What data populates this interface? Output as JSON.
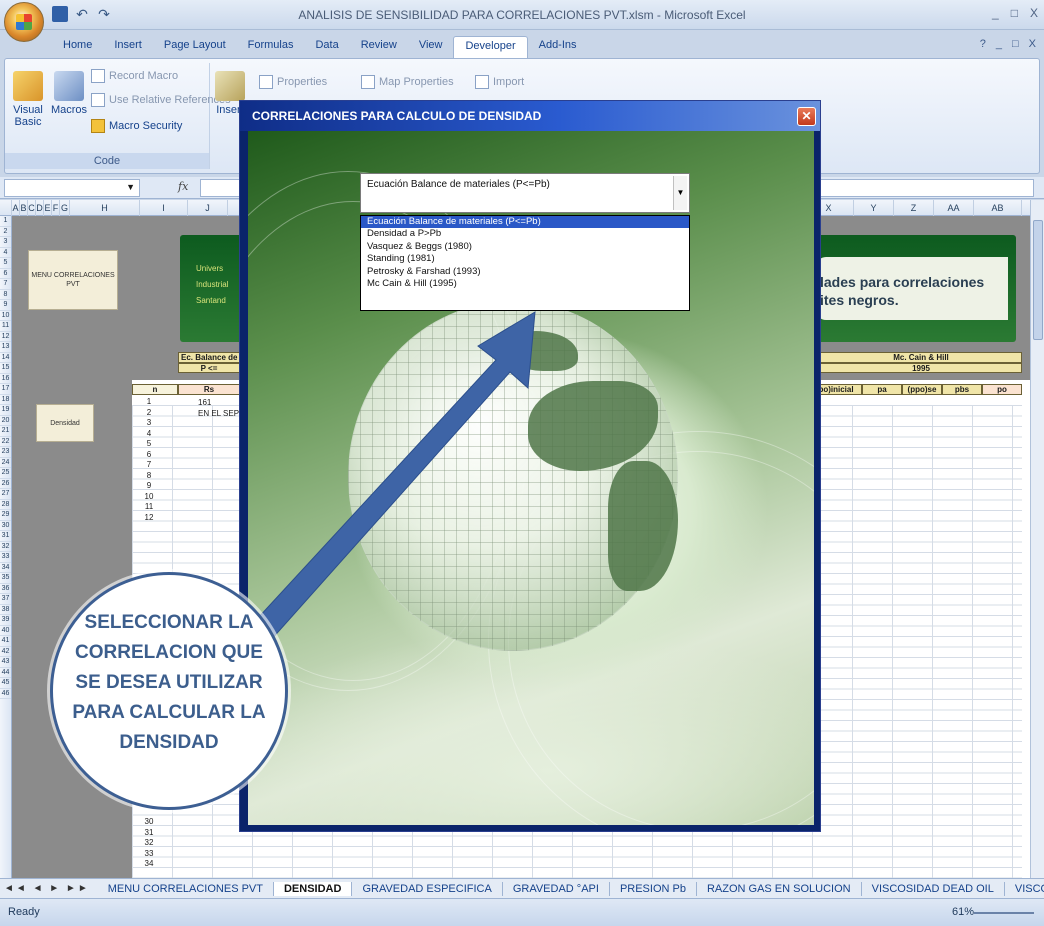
{
  "window": {
    "title": "ANALISIS DE SENSIBILIDAD PARA CORRELACIONES PVT.xlsm - Microsoft Excel",
    "controls": [
      "_",
      "□",
      "X"
    ]
  },
  "ribbon": {
    "tabs": [
      "Home",
      "Insert",
      "Page Layout",
      "Formulas",
      "Data",
      "Review",
      "View",
      "Developer",
      "Add-Ins"
    ],
    "active_tab": "Developer",
    "code_group": {
      "label": "Code",
      "visual_basic": "Visual Basic",
      "macros": "Macros",
      "record_macro": "Record Macro",
      "use_relative": "Use Relative References",
      "macro_security": "Macro Security"
    },
    "controls_group": {
      "insert": "Insert",
      "properties": "Properties",
      "map_properties": "Map Properties",
      "import": "Import"
    }
  },
  "formula_bar": {
    "fx": "fx"
  },
  "sheet": {
    "columns": [
      "A",
      "B",
      "C",
      "D",
      "E",
      "F",
      "G",
      "H",
      "I",
      "J",
      "X",
      "Y",
      "Z",
      "AA",
      "AB"
    ],
    "rows": [
      "1",
      "2",
      "3",
      "4",
      "5",
      "6",
      "7",
      "8",
      "9",
      "10",
      "11",
      "12",
      "13",
      "14",
      "15",
      "16",
      "17",
      "18",
      "19",
      "20",
      "21",
      "22",
      "23",
      "24",
      "25",
      "26",
      "27",
      "28",
      "29",
      "30",
      "31",
      "32",
      "33",
      "34",
      "35",
      "36",
      "37",
      "38",
      "39",
      "40",
      "41",
      "42",
      "43",
      "44",
      "45",
      "46"
    ],
    "menu_button": "MENU CORRELACIONES PVT",
    "density_button": "Densidad",
    "banner_left": [
      "Univers",
      "Industrial",
      "Santand"
    ],
    "banner_right": [
      "lades para correlaciones",
      "ites negros."
    ],
    "left_table_head": "Ec. Balance de",
    "left_table_sub": "P <=",
    "left_cols": [
      "n",
      "Rs"
    ],
    "right_table_head": "Mc. Cain & Hill",
    "right_table_year": "1995",
    "right_cols": [
      "po)inicial",
      "pa",
      "(ppo)se",
      "pbs",
      "po"
    ],
    "n_values": [
      "1",
      "2",
      "3",
      "4",
      "5",
      "6",
      "7",
      "8",
      "9",
      "10",
      "11",
      "12"
    ],
    "n_values_bottom": [
      "30",
      "31",
      "32",
      "33",
      "34"
    ],
    "rs_value": "161",
    "sep_text": "EN EL SEP"
  },
  "dialog": {
    "title": "CORRELACIONES PARA CALCULO DE DENSIDAD",
    "selected_value": "Ecuación Balance de materiales (P<=Pb)",
    "options": [
      "Ecuación Balance de materiales (P<=Pb)",
      "Densidad a P>Pb",
      "Vasquez & Beggs (1980)",
      "Standing (1981)",
      "Petrosky & Farshad (1993)",
      "Mc Cain & Hill (1995)"
    ],
    "highlighted_index": 0
  },
  "annotation": {
    "lines": [
      "SELECCIONAR LA",
      "CORRELACION QUE",
      "SE DESEA UTILIZAR",
      "PARA CALCULAR LA",
      "DENSIDAD"
    ]
  },
  "sheet_tabs": {
    "tabs": [
      "MENU CORRELACIONES PVT",
      "DENSIDAD",
      "GRAVEDAD ESPECIFICA",
      "GRAVEDAD °API",
      "PRESION Pb",
      "RAZON GAS EN SOLUCION",
      "VISCOSIDAD DEAD OIL",
      "VISCOSIDAD PE"
    ],
    "active": "DENSIDAD"
  },
  "status": {
    "ready": "Ready",
    "zoom": "61%"
  },
  "colors": {
    "dialog_title_start": "#0f2d87",
    "accent_blue": "#3c5e8d",
    "sheet_green": "#0d5b1f",
    "table_head": "#f0e5a8"
  }
}
